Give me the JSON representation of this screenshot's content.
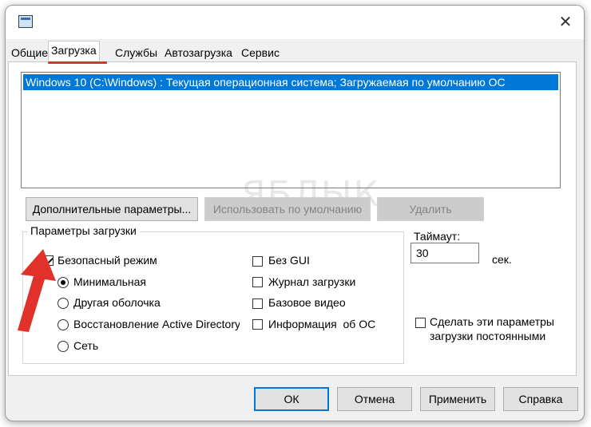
{
  "window": {
    "title_icon": "msconfig-app-icon",
    "close_glyph": "✕"
  },
  "tabs": [
    {
      "label": "Общие",
      "active": false
    },
    {
      "label": "Загрузка",
      "active": true
    },
    {
      "label": "Службы",
      "active": false
    },
    {
      "label": "Автозагрузка",
      "active": false
    },
    {
      "label": "Сервис",
      "active": false
    }
  ],
  "boot_list": {
    "items": [
      "Windows 10 (C:\\Windows) : Текущая операционная система; Загружаемая по умолчанию ОС"
    ],
    "selected_index": 0
  },
  "buttons": {
    "advanced": "Дополнительные параметры...",
    "set_default": "Использовать по умолчанию",
    "delete": "Удалить"
  },
  "boot_options": {
    "title": "Параметры загрузки",
    "safe_boot": {
      "label": "Безопасный режим",
      "checked": true
    },
    "safe_modes": [
      {
        "label": "Минимальная",
        "checked": true
      },
      {
        "label": "Другая оболочка",
        "checked": false
      },
      {
        "label": "Восстановление Active Directory",
        "checked": false
      },
      {
        "label": "Сеть",
        "checked": false
      }
    ],
    "right_options": [
      {
        "label": "Без GUI",
        "checked": false
      },
      {
        "label": "Журнал загрузки",
        "checked": false
      },
      {
        "label": "Базовое видео",
        "checked": false
      },
      {
        "label": "Информация  об ОС",
        "checked": false
      }
    ]
  },
  "timeout": {
    "label": "Таймаут:",
    "value": "30",
    "unit": "сек."
  },
  "make_permanent": {
    "line1": "Сделать эти параметры",
    "line2": "загрузки постоянными",
    "checked": false
  },
  "footer": {
    "ok": "ОК",
    "cancel": "Отмена",
    "apply": "Применить",
    "help": "Справка"
  },
  "watermark": "ЯБЛЫК",
  "colors": {
    "accent": "#0078d7",
    "annotation_arrow": "#e0322b"
  }
}
